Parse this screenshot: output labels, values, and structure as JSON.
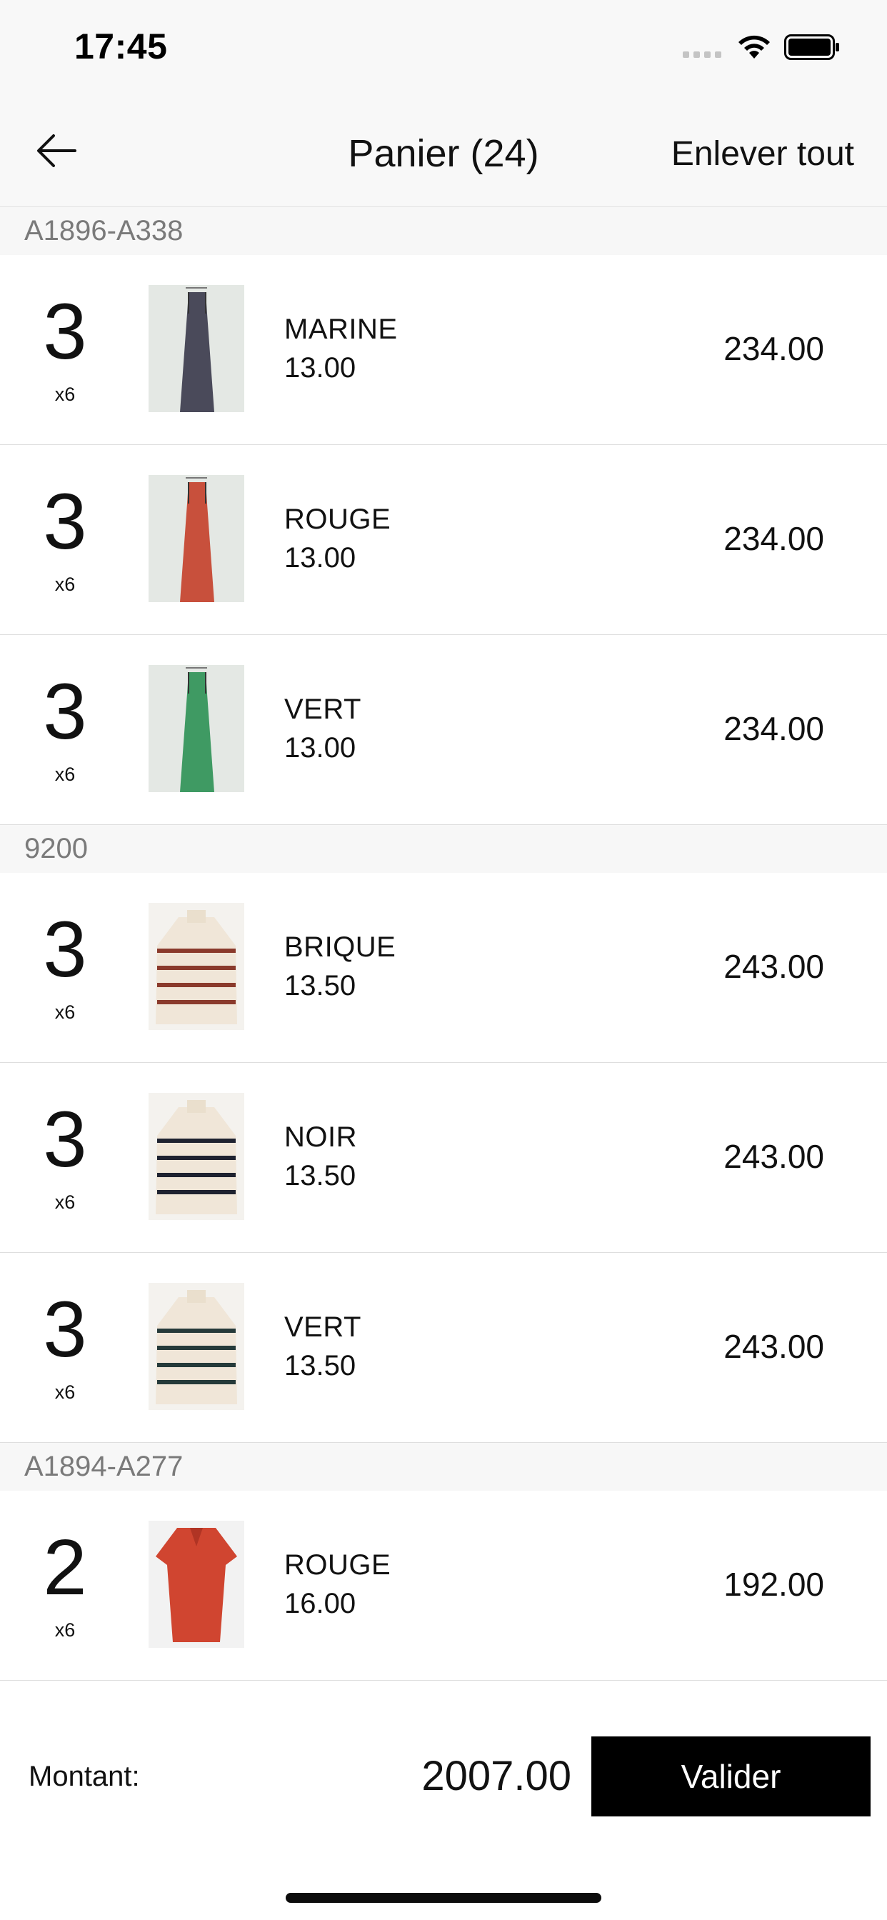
{
  "status_bar": {
    "time": "17:45"
  },
  "nav": {
    "title": "Panier (24)",
    "clear_label": "Enlever tout"
  },
  "sections": [
    {
      "title": "A1896-A338",
      "items": [
        {
          "qty": "3",
          "mult": "x6",
          "color": "MARINE",
          "unit_price": "13.00",
          "total": "234.00",
          "swatch": "#4a4a5a"
        },
        {
          "qty": "3",
          "mult": "x6",
          "color": "ROUGE",
          "unit_price": "13.00",
          "total": "234.00",
          "swatch": "#c8503c"
        },
        {
          "qty": "3",
          "mult": "x6",
          "color": "VERT",
          "unit_price": "13.00",
          "total": "234.00",
          "swatch": "#3f9a63"
        }
      ]
    },
    {
      "title": "9200",
      "items": [
        {
          "qty": "3",
          "mult": "x6",
          "color": "BRIQUE",
          "unit_price": "13.50",
          "total": "243.00",
          "swatch": "#8a3a2c"
        },
        {
          "qty": "3",
          "mult": "x6",
          "color": "NOIR",
          "unit_price": "13.50",
          "total": "243.00",
          "swatch": "#1e2230"
        },
        {
          "qty": "3",
          "mult": "x6",
          "color": "VERT",
          "unit_price": "13.50",
          "total": "243.00",
          "swatch": "#253a3a"
        }
      ]
    },
    {
      "title": "A1894-A277",
      "items": [
        {
          "qty": "2",
          "mult": "x6",
          "color": "ROUGE",
          "unit_price": "16.00",
          "total": "192.00",
          "swatch": "#d04530"
        }
      ]
    }
  ],
  "footer": {
    "amount_label": "Montant:",
    "amount_value": "2007.00",
    "validate_label": "Valider"
  }
}
